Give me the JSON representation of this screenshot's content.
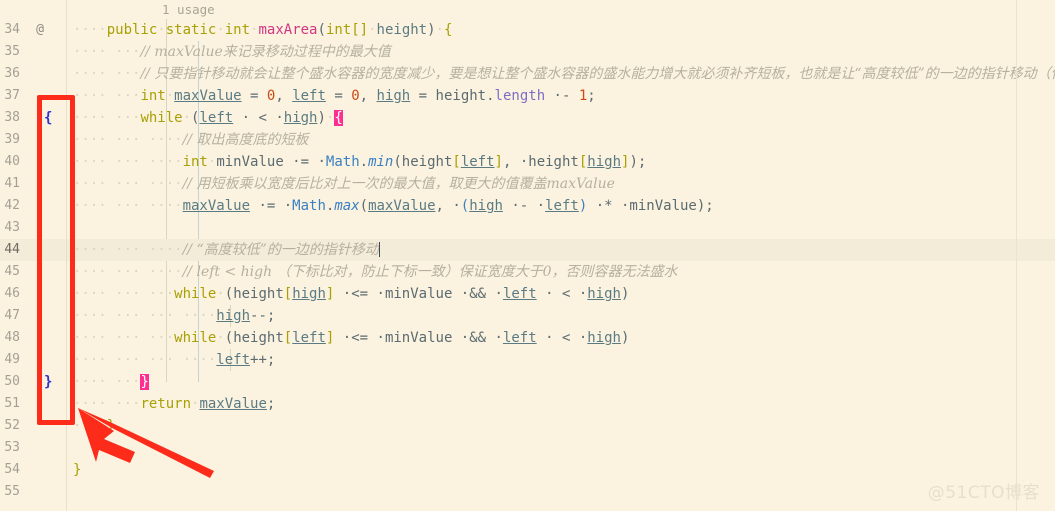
{
  "editor": {
    "theme_background": "#fbf3df",
    "usage_hint": "1 usage",
    "gutter_icon": "@",
    "current_line": 44,
    "watermark": "@51CTO博客",
    "fold_open_brace": "{",
    "fold_close_brace": "}",
    "lines": [
      {
        "num": "34",
        "indent": 0
      },
      {
        "num": "35",
        "indent": 0
      },
      {
        "num": "36",
        "indent": 0
      },
      {
        "num": "37",
        "indent": 0
      },
      {
        "num": "38",
        "indent": 0
      },
      {
        "num": "39",
        "indent": 0
      },
      {
        "num": "40",
        "indent": 0
      },
      {
        "num": "41",
        "indent": 0
      },
      {
        "num": "42",
        "indent": 0
      },
      {
        "num": "43",
        "indent": 0
      },
      {
        "num": "44",
        "indent": 0
      },
      {
        "num": "45",
        "indent": 0
      },
      {
        "num": "46",
        "indent": 0
      },
      {
        "num": "47",
        "indent": 0
      },
      {
        "num": "48",
        "indent": 0
      },
      {
        "num": "49",
        "indent": 0
      },
      {
        "num": "50",
        "indent": 0
      },
      {
        "num": "51",
        "indent": 0
      },
      {
        "num": "52",
        "indent": 0
      },
      {
        "num": "53",
        "indent": 0
      },
      {
        "num": "54",
        "indent": 0
      },
      {
        "num": "55",
        "indent": 0
      }
    ],
    "code": {
      "l34": "public static int maxArea(int[] height) {",
      "l35": "// maxValue来记录移动过程中的最大值",
      "l36": "// 只要指针移动就会让整个盛水容器的宽度减少，要是想让整个盛水容器的盛水能力增大就必须补齐短板，也就是让“高度较低”的一边的指针移动（保证宽度）",
      "l37": "int maxValue = 0, left = 0, high = height.length - 1;",
      "l38": "while (left < high) {",
      "l39": "// 取出高度底的短板",
      "l40": "int minValue = Math.min(height[left], height[high]);",
      "l41": "// 用短板乘以宽度后比对上一次的最大值，取更大的值覆盖maxValue",
      "l42": "maxValue = Math.max(maxValue, (high - left) * minValue);",
      "l43": "",
      "l44": "// “高度较低”的一边的指针移动",
      "l45": "// left < high （下标比对，防止下标一致）保证宽度大于0，否则容器无法盛水",
      "l46": "while (height[high] <= minValue && left < high)",
      "l47": "high--;",
      "l48": "while (height[left] <= minValue && left < high)",
      "l49": "left++;",
      "l50": "}",
      "l51": "return maxValue;",
      "l52": "}",
      "l53": "",
      "l54": "}",
      "l55": ""
    },
    "tokens": {
      "kw_public": "public",
      "kw_static": "static",
      "kw_int": "int",
      "kw_while": "while",
      "kw_return": "return",
      "method_name": "maxArea",
      "param_type": "int[]",
      "param_name": "height",
      "var_maxValue": "maxValue",
      "var_left": "left",
      "var_high": "high",
      "var_minValue": "minValue",
      "cls_Math": "Math",
      "call_min": "min",
      "call_max": "max",
      "fld_length": "length",
      "num_zero": "0",
      "num_one": "1"
    },
    "colors": {
      "keyword": "#a8a005",
      "method": "#d33682",
      "class": "#3b7fc4",
      "number": "#cb4b16",
      "variable": "#5b7b84",
      "comment": "#b6b0a0",
      "bracket_match": "#ff2e92",
      "annotation_red": "#fc2b1a",
      "current_line_bg": "#f2ecd8"
    }
  }
}
